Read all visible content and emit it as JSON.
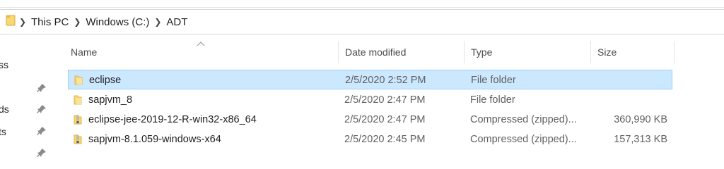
{
  "breadcrumb": {
    "items": [
      "This PC",
      "Windows (C:)",
      "ADT"
    ]
  },
  "nav": {
    "items": [
      "ss",
      "ds",
      "ts"
    ]
  },
  "columns": {
    "name": "Name",
    "date": "Date modified",
    "type": "Type",
    "size": "Size"
  },
  "files": [
    {
      "name": "eclipse",
      "date": "2/5/2020 2:52 PM",
      "type": "File folder",
      "size": "",
      "icon": "folder-icon",
      "selected": true
    },
    {
      "name": "sapjvm_8",
      "date": "2/5/2020 2:47 PM",
      "type": "File folder",
      "size": "",
      "icon": "folder-icon",
      "selected": false
    },
    {
      "name": "eclipse-jee-2019-12-R-win32-x86_64",
      "date": "2/5/2020 2:47 PM",
      "type": "Compressed (zipped)...",
      "size": "360,990 KB",
      "icon": "zip-folder-icon",
      "selected": false
    },
    {
      "name": "sapjvm-8.1.059-windows-x64",
      "date": "2/5/2020 2:45 PM",
      "type": "Compressed (zipped)...",
      "size": "157,313 KB",
      "icon": "zip-folder-icon",
      "selected": false
    }
  ],
  "colors": {
    "selection_bg": "#cce8ff",
    "selection_border": "#99d1ff",
    "folder_yellow": "#f8d775"
  }
}
